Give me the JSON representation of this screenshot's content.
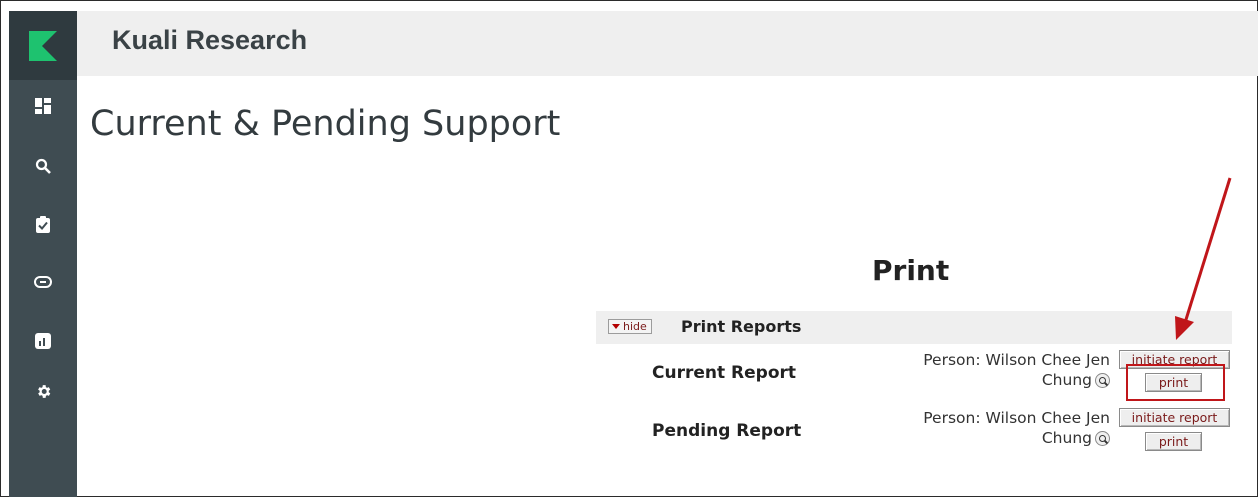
{
  "app": {
    "title": "Kuali Research"
  },
  "sidebar": {
    "items": [
      {
        "icon": "dashboard-icon"
      },
      {
        "icon": "search-icon"
      },
      {
        "icon": "clipboard-check-icon"
      },
      {
        "icon": "link-icon"
      },
      {
        "icon": "chart-icon"
      },
      {
        "icon": "gear-icon"
      }
    ]
  },
  "page": {
    "title": "Current & Pending Support",
    "print_heading": "Print"
  },
  "section": {
    "toggle_label": "hide",
    "title": "Print Reports"
  },
  "reports": [
    {
      "label": "Current Report",
      "person_line1": "Person: Wilson Chee Jen",
      "person_line2": "Chung",
      "initiate_label": "initiate report",
      "print_label": "print"
    },
    {
      "label": "Pending Report",
      "person_line1": "Person: Wilson Chee Jen",
      "person_line2": "Chung",
      "initiate_label": "initiate report",
      "print_label": "print"
    }
  ],
  "colors": {
    "sidebar": "#3f4c52",
    "brand": "#1ec26f",
    "annotation": "#c0161a",
    "button_text": "#7a1a1a"
  }
}
